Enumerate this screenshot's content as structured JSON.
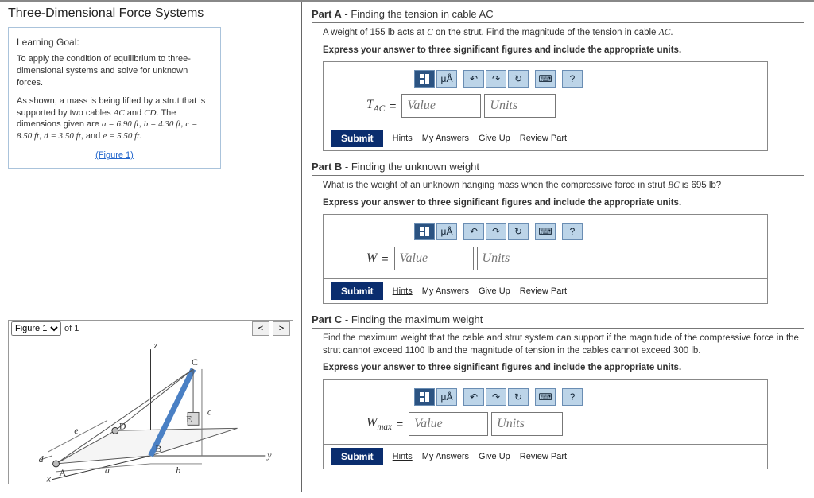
{
  "page_title": "Three-Dimensional Force Systems",
  "learning_goal": {
    "heading": "Learning Goal:",
    "para1": "To apply the condition of equilibrium to three-dimensional systems and solve for unknown forces.",
    "para2_pre": "As shown, a mass is being lifted by a strut that is supported by two cables ",
    "para2_ac": "AC",
    "para2_and": " and ",
    "para2_cd": "CD",
    "para2_dims_pre": ". The dimensions given are ",
    "a_eq": "a = 6.90 ft",
    "b_eq": "b = 4.30 ft",
    "c_eq": "c = 8.50 ft",
    "d_eq": "d = 3.50 ft",
    "e_eq": "e = 5.50 ft",
    "figure_link": "(Figure 1)"
  },
  "figure_toolbar": {
    "select": "Figure 1",
    "of_label": "of 1"
  },
  "figure_labels": {
    "z": "z",
    "y": "y",
    "x": "x",
    "A": "A",
    "B": "B",
    "C": "C",
    "D": "D",
    "E": "E",
    "a": "a",
    "b": "b",
    "c": "c",
    "d": "d",
    "e": "e"
  },
  "toolbar_icons": {
    "tmpl": "template-icon",
    "ua": "μÅ",
    "undo": "↶",
    "redo": "↷",
    "reset": "↻",
    "kbd": "⌨",
    "help": "?"
  },
  "input_placeholders": {
    "value": "Value",
    "units": "Units"
  },
  "actions": {
    "submit": "Submit",
    "hints": "Hints",
    "myans": "My Answers",
    "giveup": "Give Up",
    "review": "Review Part"
  },
  "partA": {
    "label": "Part A",
    "title": " - Finding the tension in cable AC",
    "p1_pre": "A weight of ",
    "p1_w": "155 lb",
    "p1_mid": " acts at ",
    "p1_c": "C",
    "p1_post": " on the strut. Find the magnitude of the tension in cable ",
    "p1_ac": "AC",
    "p1_end": ".",
    "p2": "Express your answer to three significant figures and include the appropriate units.",
    "var_html": "T",
    "var_sub": "AC"
  },
  "partB": {
    "label": "Part B",
    "title": " - Finding the unknown weight",
    "p1_pre": "What is the weight of an unknown hanging mass when the compressive force in strut ",
    "p1_bc": "BC",
    "p1_mid": " is ",
    "p1_val": "695 lb",
    "p1_end": "?",
    "p2": "Express your answer to three significant figures and include the appropriate units.",
    "var_html": "W"
  },
  "partC": {
    "label": "Part C",
    "title": " - Finding the maximum weight",
    "p1_pre": "Find the maximum weight that the cable and strut system can support if the magnitude of the compressive force in the strut cannot exceed ",
    "p1_v1": "1100 lb",
    "p1_mid": " and the magnitude of tension in the cables cannot exceed ",
    "p1_v2": "300 lb",
    "p1_end": ".",
    "p2": "Express your answer to three significant figures and include the appropriate units.",
    "var_html": "W",
    "var_sub": "max"
  }
}
